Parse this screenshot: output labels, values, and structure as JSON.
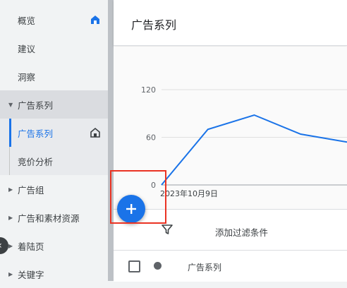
{
  "sidebar": {
    "items": [
      {
        "label": "概览",
        "has_home_icon": true
      },
      {
        "label": "建议"
      },
      {
        "label": "洞察"
      },
      {
        "label": "广告系列",
        "section": true,
        "expanded": true
      },
      {
        "label": "广告系列",
        "active": true,
        "has_home_icon": true
      },
      {
        "label": "竞价分析"
      },
      {
        "label": "广告组",
        "collapsed": true
      },
      {
        "label": "广告和素材资源",
        "collapsed": true
      },
      {
        "label": "着陆页",
        "collapsed": true
      },
      {
        "label": "关键字",
        "collapsed": true
      }
    ]
  },
  "header": {
    "title": "广告系列"
  },
  "chart_data": {
    "type": "line",
    "y_ticks": [
      "120",
      "60",
      "0"
    ],
    "ylim": [
      0,
      120
    ],
    "x_start_label": "2023年10月9日",
    "series": [
      {
        "values": [
          0,
          70,
          88,
          64,
          54
        ],
        "color": "#1a73e8"
      }
    ],
    "grid": true
  },
  "filter": {
    "label": "添加过滤条件",
    "icon": "filter-icon"
  },
  "table": {
    "columns": [
      "广告系列"
    ]
  },
  "fab": {
    "icon": "plus-icon"
  },
  "colors": {
    "accent": "#1a73e8",
    "highlight": "#ea3323"
  }
}
